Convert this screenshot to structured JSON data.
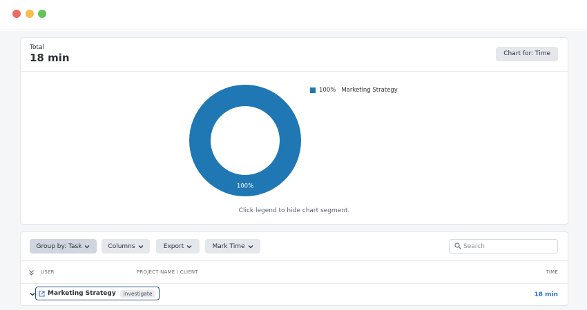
{
  "window": {
    "controls": [
      "close",
      "minimize",
      "maximize"
    ],
    "colors": {
      "close": "#ed6a5e",
      "minimize": "#f5bf4f",
      "maximize": "#62c554"
    }
  },
  "summary": {
    "total_label": "Total",
    "total_value": "18 min",
    "chart_for_label": "Chart for: Time"
  },
  "chart_data": {
    "type": "pie",
    "variant": "donut",
    "categories": [
      "Marketing Strategy"
    ],
    "values": [
      100
    ],
    "colors": [
      "#1f77b4"
    ],
    "slice_labels": [
      "100%"
    ],
    "legend": [
      {
        "percent": "100%",
        "name": "Marketing Strategy"
      }
    ],
    "legend_placement": "top-right",
    "hint": "Click legend to hide chart segment."
  },
  "toolbar": {
    "group_by_label": "Group by: Task",
    "columns_label": "Columns",
    "export_label": "Export",
    "mark_time_label": "Mark Time",
    "search_placeholder": "Search",
    "search_value": ""
  },
  "table": {
    "columns": [
      "USER",
      "PROJECT NAME / CLIENT",
      "TIME"
    ],
    "rows": [
      {
        "task": "Marketing Strategy",
        "tag": "investigate",
        "time": "18 min"
      }
    ]
  },
  "colors": {
    "accent": "#2f6fde",
    "chart_series": "#1f77b4",
    "active_button": "#cfd6e0"
  }
}
